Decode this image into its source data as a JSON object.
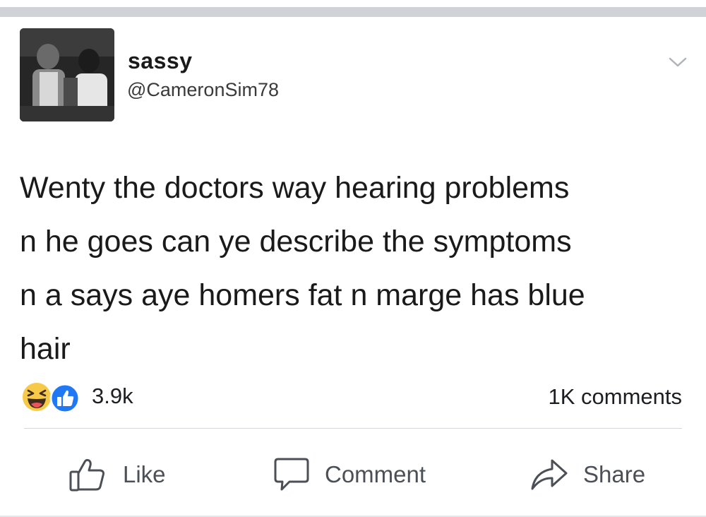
{
  "post": {
    "author": {
      "display_name": "sassy",
      "handle": "@CameronSim78",
      "avatar_icon": "avatar-photo"
    },
    "menu_icon": "chevron-down-icon",
    "text": "Wenty the doctors way hearing problems\nn he goes can ye describe the symptoms\nn a says aye homers fat n marge has blue\nhair",
    "reactions": {
      "icons": [
        "haha-icon",
        "like-icon"
      ],
      "count": "3.9k"
    },
    "comments_count": "1K comments"
  },
  "actions": {
    "like_label": "Like",
    "comment_label": "Comment",
    "share_label": "Share"
  },
  "colors": {
    "like_blue": "#2078f4",
    "haha_yellow": "#f7c948",
    "action_gray": "#4b4f56",
    "divider": "#d5d7da"
  }
}
